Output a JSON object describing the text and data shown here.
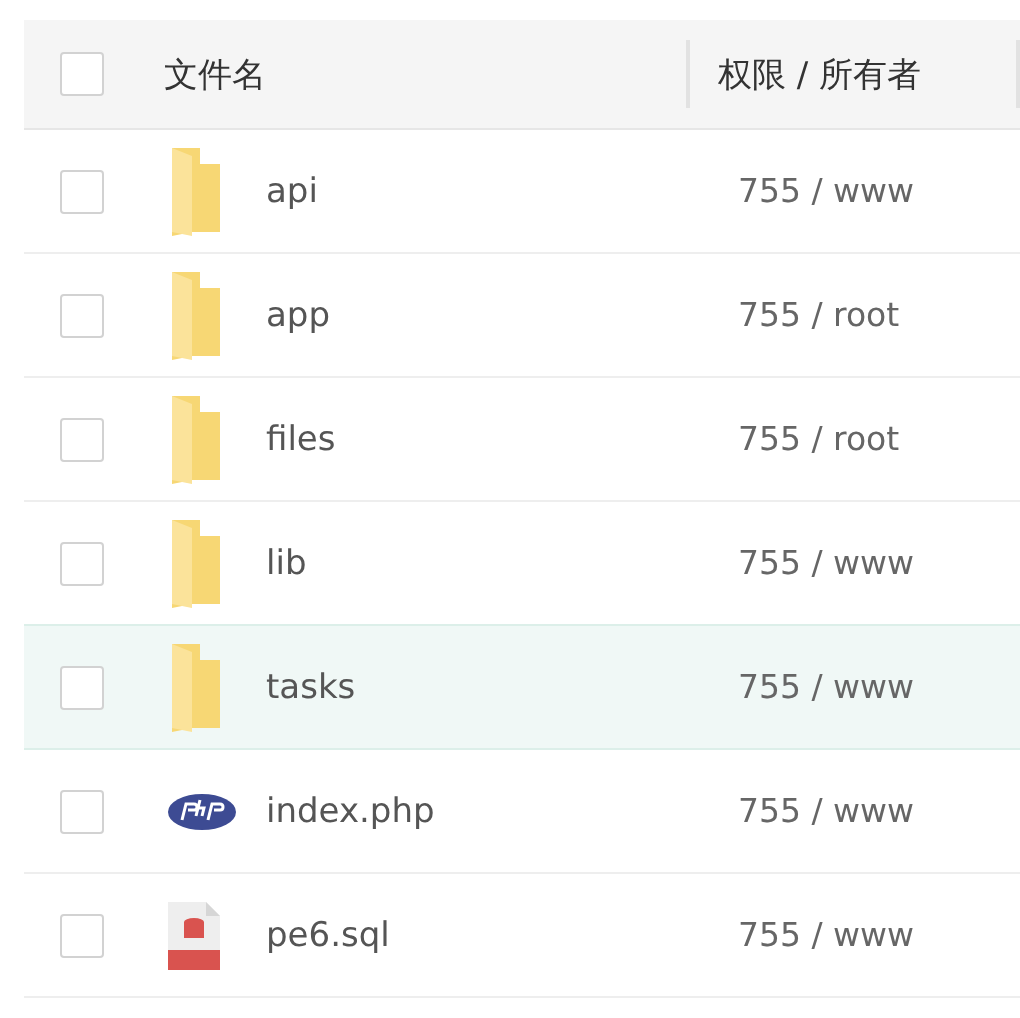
{
  "table": {
    "columns": [
      {
        "label": "文件名"
      },
      {
        "label": "权限 / 所有者"
      }
    ],
    "header_checked": false,
    "rows": [
      {
        "name": "api",
        "kind": "folder",
        "permission": "755 / www",
        "checked": false,
        "selected": false
      },
      {
        "name": "app",
        "kind": "folder",
        "permission": "755 / root",
        "checked": false,
        "selected": false
      },
      {
        "name": "files",
        "kind": "folder",
        "permission": "755 / root",
        "checked": false,
        "selected": false
      },
      {
        "name": "lib",
        "kind": "folder",
        "permission": "755 / www",
        "checked": false,
        "selected": false
      },
      {
        "name": "tasks",
        "kind": "folder",
        "permission": "755 / www",
        "checked": false,
        "selected": true
      },
      {
        "name": "index.php",
        "kind": "php",
        "permission": "755 / www",
        "checked": false,
        "selected": false
      },
      {
        "name": "pe6.sql",
        "kind": "sql",
        "permission": "755 / www",
        "checked": false,
        "selected": false
      }
    ]
  }
}
